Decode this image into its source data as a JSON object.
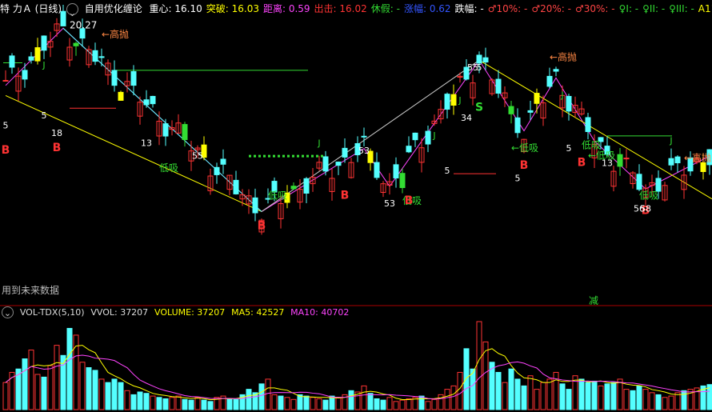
{
  "header": {
    "stock_name": "特 力Ａ",
    "period": "(日线)",
    "indicator_name": "自用优化缠论",
    "items": [
      {
        "label": "重心:",
        "value": "16.10",
        "color": "#ffffff"
      },
      {
        "label": "突破:",
        "value": "16.03",
        "color": "#ffff00"
      },
      {
        "label": "距离:",
        "value": "0.59",
        "color": "#ff44ff"
      },
      {
        "label": "出击:",
        "value": "16.02",
        "color": "#ff3333"
      },
      {
        "label": "休假:",
        "value": "-",
        "color": "#33dd33"
      },
      {
        "label": "涨幅:",
        "value": "0.62",
        "color": "#3355ff"
      },
      {
        "label": "跌幅:",
        "value": "-",
        "color": "#ffffff"
      },
      {
        "label": "♂10%:",
        "value": "-",
        "color": "#ff4444"
      },
      {
        "label": "♂20%:",
        "value": "-",
        "color": "#ff4444"
      },
      {
        "label": "♂30%:",
        "value": "-",
        "color": "#ff4444"
      },
      {
        "label": "♀I:",
        "value": "-",
        "color": "#33dd33"
      },
      {
        "label": "♀II:",
        "value": "-",
        "color": "#33dd33"
      },
      {
        "label": "♀III:",
        "value": "-",
        "color": "#33dd33"
      },
      {
        "label": "A11:",
        "value": "-",
        "color": "#ffff00"
      },
      {
        "label": "B1:",
        "value": "-",
        "color": "#ff44ff"
      }
    ]
  },
  "note_text": "用到未来数据",
  "jian_text": "减",
  "volume_header": {
    "name": "VOL-TDX(5,10)",
    "vvol": "VVOL: 37207",
    "volume": "VOLUME: 37207",
    "ma5": "MA5: 42527",
    "ma10": "MA10: 40702"
  },
  "colors": {
    "up": "#ff3333",
    "down": "#54ffff",
    "yellow_bar": "#ffff00",
    "green_bar": "#33dd33",
    "ma5": "#ffff00",
    "ma10": "#ff44ff",
    "separator": "#aa0000"
  },
  "annotations": {
    "price_labels": [
      {
        "text": "20.27",
        "color": "#ffffff"
      },
      {
        "text": "←高抛",
        "color": "#ff8844"
      },
      {
        "text": "←高抛",
        "color": "#ff8844"
      },
      {
        "text": "低吸",
        "color": "#33dd33"
      },
      {
        "text": "低吸",
        "color": "#33dd33"
      },
      {
        "text": "低吸",
        "color": "#33dd33"
      },
      {
        "text": "低吸",
        "color": "#33dd33"
      },
      {
        "text": "←低吸",
        "color": "#33dd33"
      },
      {
        "text": "低吸",
        "color": "#33dd33"
      },
      {
        "text": "←低吸",
        "color": "#33dd33"
      },
      {
        "text": "←高抛",
        "color": "#ff8844"
      }
    ],
    "markers": [
      {
        "text": "B",
        "color": "#ff3333"
      },
      {
        "text": "S",
        "color": "#33dd33"
      },
      {
        "text": "J",
        "color": "#33dd33"
      },
      {
        "text": "5",
        "color": "#ffffff"
      },
      {
        "text": "13",
        "color": "#ffffff"
      },
      {
        "text": "55",
        "color": "#ffffff"
      },
      {
        "text": "34",
        "color": "#ffffff"
      },
      {
        "text": "53",
        "color": "#ffffff"
      },
      {
        "text": "56",
        "color": "#ffffff"
      },
      {
        "text": "58",
        "color": "#ffffff"
      },
      {
        "text": "18",
        "color": "#ffffff"
      }
    ]
  },
  "chart_data": [
    {
      "type": "candlestick",
      "title": "自用优化缠论",
      "n_bars": 111,
      "y_range": [
        12.0,
        20.5
      ],
      "high_label": 20.27,
      "pivots": [
        {
          "i": 0,
          "price": 18.0
        },
        {
          "i": 9,
          "price": 20.27
        },
        {
          "i": 40,
          "price": 13.0
        },
        {
          "i": 56,
          "price": 15.5
        },
        {
          "i": 60,
          "price": 14.0
        },
        {
          "i": 74,
          "price": 19.0
        },
        {
          "i": 81,
          "price": 16.2
        },
        {
          "i": 86,
          "price": 18.3
        },
        {
          "i": 92,
          "price": 15.8
        },
        {
          "i": 100,
          "price": 13.9
        },
        {
          "i": 110,
          "price": 15.2
        }
      ]
    },
    {
      "type": "bar",
      "title": "VOL-TDX(5,10)",
      "series": [
        {
          "name": "VOLUME",
          "last": 37207
        },
        {
          "name": "MA5",
          "last": 42527
        },
        {
          "name": "MA10",
          "last": 40702
        }
      ],
      "volumes": [
        40,
        55,
        60,
        75,
        88,
        52,
        48,
        65,
        95,
        80,
        120,
        110,
        70,
        62,
        58,
        45,
        40,
        45,
        40,
        28,
        22,
        26,
        24,
        20,
        18,
        16,
        18,
        20,
        15,
        14,
        18,
        14,
        12,
        18,
        20,
        16,
        15,
        22,
        30,
        25,
        38,
        45,
        22,
        20,
        18,
        15,
        22,
        20,
        18,
        16,
        14,
        20,
        18,
        22,
        28,
        26,
        35,
        24,
        16,
        14,
        18,
        12,
        14,
        16,
        18,
        20,
        12,
        15,
        22,
        30,
        35,
        55,
        90,
        60,
        130,
        100,
        70,
        55,
        40,
        60,
        45,
        35,
        50,
        30,
        40,
        45,
        55,
        38,
        30,
        50,
        45,
        40,
        42,
        35,
        38,
        40,
        45,
        30,
        28,
        35,
        30,
        25,
        22,
        18,
        20,
        25,
        28,
        30,
        32,
        35,
        37
      ]
    }
  ]
}
